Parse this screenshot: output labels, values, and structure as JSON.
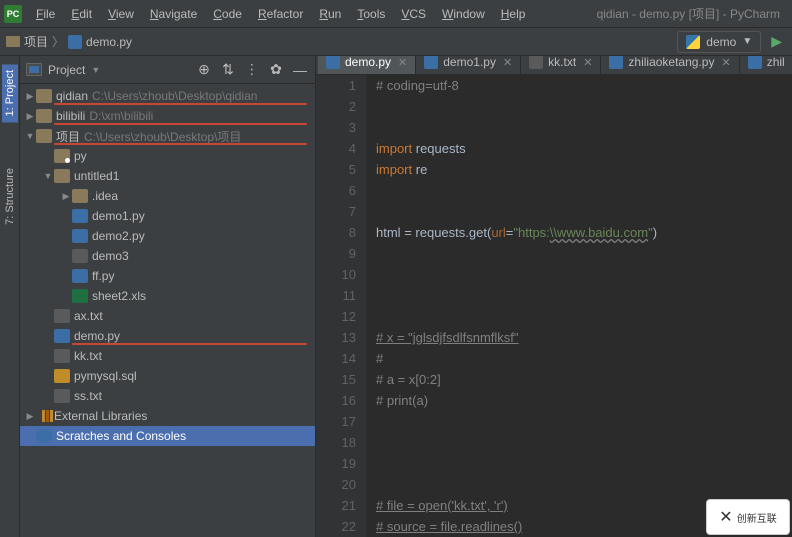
{
  "window": {
    "title": "qidian - demo.py [项目] - PyCharm",
    "app_icon": "PC"
  },
  "menu": [
    "File",
    "Edit",
    "View",
    "Navigate",
    "Code",
    "Refactor",
    "Run",
    "Tools",
    "VCS",
    "Window",
    "Help"
  ],
  "breadcrumb": {
    "folder": "项目",
    "file": "demo.py"
  },
  "run_config": {
    "name": "demo"
  },
  "panel": {
    "title": "Project",
    "roots": [
      {
        "arrow": "closed",
        "icon": "folder",
        "name": "qidian",
        "path": "C:\\Users\\zhoub\\Desktop\\qidian",
        "redline": true,
        "indent": 0
      },
      {
        "arrow": "closed",
        "icon": "folder",
        "name": "bilibili",
        "path": "D:\\xm\\bilibili",
        "redline": true,
        "indent": 0
      },
      {
        "arrow": "open",
        "icon": "folder",
        "name": "项目",
        "path": "C:\\Users\\zhoub\\Desktop\\项目",
        "redline": true,
        "indent": 0
      },
      {
        "arrow": "none",
        "icon": "pkg",
        "name": "py",
        "indent": 1
      },
      {
        "arrow": "open",
        "icon": "folder",
        "name": "untitled1",
        "indent": 1
      },
      {
        "arrow": "closed",
        "icon": "folder",
        "name": ".idea",
        "indent": 2
      },
      {
        "arrow": "none",
        "icon": "py",
        "name": "demo1.py",
        "indent": 2
      },
      {
        "arrow": "none",
        "icon": "py",
        "name": "demo2.py",
        "indent": 2
      },
      {
        "arrow": "none",
        "icon": "txt",
        "name": "demo3",
        "indent": 2
      },
      {
        "arrow": "none",
        "icon": "py",
        "name": "ff.py",
        "indent": 2
      },
      {
        "arrow": "none",
        "icon": "xls",
        "name": "sheet2.xls",
        "indent": 2
      },
      {
        "arrow": "none",
        "icon": "txt",
        "name": "ax.txt",
        "indent": 1
      },
      {
        "arrow": "none",
        "icon": "py",
        "name": "demo.py",
        "indent": 1,
        "redline": true
      },
      {
        "arrow": "none",
        "icon": "txt",
        "name": "kk.txt",
        "indent": 1
      },
      {
        "arrow": "none",
        "icon": "sql",
        "name": "pymysql.sql",
        "indent": 1
      },
      {
        "arrow": "none",
        "icon": "txt",
        "name": "ss.txt",
        "indent": 1
      },
      {
        "arrow": "closed",
        "icon": "lib",
        "name": "External Libraries",
        "indent": -1
      },
      {
        "arrow": "none",
        "icon": "scratch",
        "name": "Scratches and Consoles",
        "indent": -1,
        "selected": true
      }
    ]
  },
  "sidebar_tabs": [
    {
      "label": "1: Project",
      "active": true
    },
    {
      "label": "7: Structure",
      "active": false
    }
  ],
  "tabs": [
    {
      "icon": "py",
      "label": "demo.py",
      "active": true
    },
    {
      "icon": "py",
      "label": "demo1.py",
      "active": false
    },
    {
      "icon": "txt",
      "label": "kk.txt",
      "active": false
    },
    {
      "icon": "py",
      "label": "zhiliaoketang.py",
      "active": false
    },
    {
      "icon": "py",
      "label": "zhil",
      "active": false
    }
  ],
  "code": {
    "lines": [
      {
        "n": 1,
        "html": "<span class='c-comment'># coding=utf-8</span>"
      },
      {
        "n": 2,
        "html": ""
      },
      {
        "n": 3,
        "html": ""
      },
      {
        "n": 4,
        "html": "<span class='c-kw'>import</span> <span class='c-ident'>requests</span>"
      },
      {
        "n": 5,
        "html": "<span class='c-kw'>import</span> <span class='c-ident'>re</span>"
      },
      {
        "n": 6,
        "html": ""
      },
      {
        "n": 7,
        "html": ""
      },
      {
        "n": 8,
        "html": "<span class='c-ident'>html</span> <span class='c-ident'>=</span> <span class='c-ident'>requests</span><span class='c-paren'>.</span><span class='c-func'>get</span><span class='c-paren'>(</span><span class='c-param'>url</span><span class='c-paren'>=</span><span class='c-str'>\"https:</span><span class='c-url'>\\\\www.baidu.com</span><span class='c-str'>\"</span><span class='c-paren'>)</span>"
      },
      {
        "n": 9,
        "html": ""
      },
      {
        "n": 10,
        "html": ""
      },
      {
        "n": 11,
        "html": ""
      },
      {
        "n": 12,
        "html": ""
      },
      {
        "n": 13,
        "html": "<span class='c-und-comment'># x = \"jglsdjfsdlfsnmflksf\"</span>"
      },
      {
        "n": 14,
        "html": "<span class='c-comment'>#</span>"
      },
      {
        "n": 15,
        "html": "<span class='c-comment'># a = x[0:2]</span>"
      },
      {
        "n": 16,
        "html": "<span class='c-comment'># print(a)</span>"
      },
      {
        "n": 17,
        "html": ""
      },
      {
        "n": 18,
        "html": ""
      },
      {
        "n": 19,
        "html": ""
      },
      {
        "n": 20,
        "html": ""
      },
      {
        "n": 21,
        "html": "<span class='c-und-comment'># file = open('kk.txt', 'r')</span>"
      },
      {
        "n": 22,
        "html": "<span class='c-und-comment'># source = file.readlines()</span>"
      }
    ]
  },
  "logo_text": "创新互联"
}
